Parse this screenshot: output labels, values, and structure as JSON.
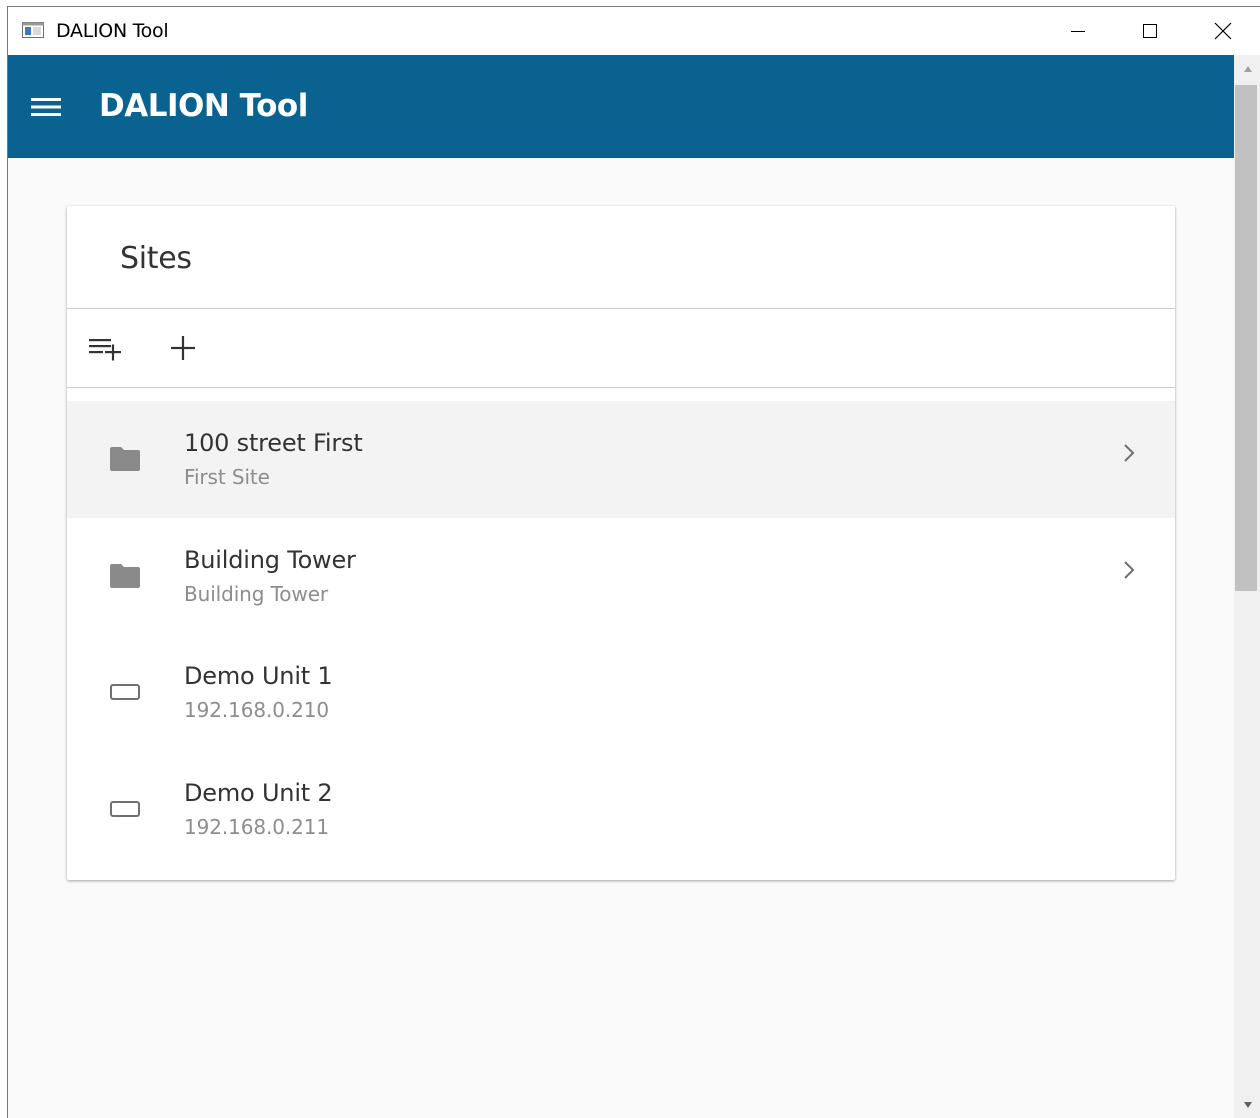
{
  "window": {
    "title": "DALION Tool"
  },
  "appbar": {
    "title": "DALION Tool"
  },
  "card": {
    "title": "Sites"
  },
  "list": {
    "items": [
      {
        "primary": "100 street First",
        "secondary": "First Site",
        "icon": "folder-icon",
        "has_chevron": true,
        "selected": true
      },
      {
        "primary": "Building Tower",
        "secondary": "Building Tower",
        "icon": "folder-icon",
        "has_chevron": true,
        "selected": false
      },
      {
        "primary": "Demo Unit 1",
        "secondary": "192.168.0.210",
        "icon": "device-icon",
        "has_chevron": false,
        "selected": false
      },
      {
        "primary": "Demo Unit 2",
        "secondary": "192.168.0.211",
        "icon": "device-icon",
        "has_chevron": false,
        "selected": false
      }
    ]
  },
  "colors": {
    "appbar": "#09628f",
    "background": "#fafafa",
    "selected_row": "#f3f3f3",
    "icon_gray": "#8a8a8a"
  }
}
